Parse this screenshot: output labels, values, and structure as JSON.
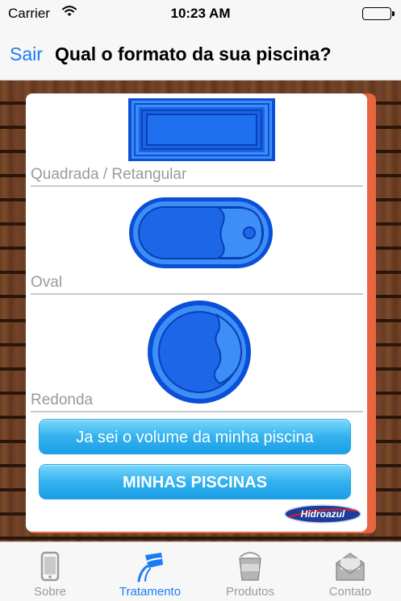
{
  "status_bar": {
    "carrier": "Carrier",
    "time": "10:23 AM",
    "battery_level": 1.0
  },
  "nav": {
    "back_label": "Sair",
    "title": "Qual o formato da sua piscina?"
  },
  "shapes": [
    {
      "label": "Quadrada / Retangular",
      "icon": "rectangular-pool-icon"
    },
    {
      "label": "Oval",
      "icon": "oval-pool-icon"
    },
    {
      "label": "Redonda",
      "icon": "round-pool-icon"
    }
  ],
  "buttons": {
    "volume_label": "Ja sei o volume da minha piscina",
    "pools_label": "MINHAS PISCINAS"
  },
  "brand": {
    "name": "Hidroazul",
    "colors": {
      "primary": "#1f3c9a",
      "accent": "#e21b23"
    }
  },
  "tabs": [
    {
      "label": "Sobre",
      "icon": "phone-icon",
      "active": false
    },
    {
      "label": "Tratamento",
      "icon": "pouring-bucket-icon",
      "active": true
    },
    {
      "label": "Produtos",
      "icon": "bucket-icon",
      "active": false
    },
    {
      "label": "Contato",
      "icon": "envelope-icon",
      "active": false
    }
  ],
  "colors": {
    "accent_blue": "#1a7cf5",
    "button_blue": "#34b2ee",
    "pool_blue": "#1e64e6",
    "frame_orange": "#e8643e"
  }
}
